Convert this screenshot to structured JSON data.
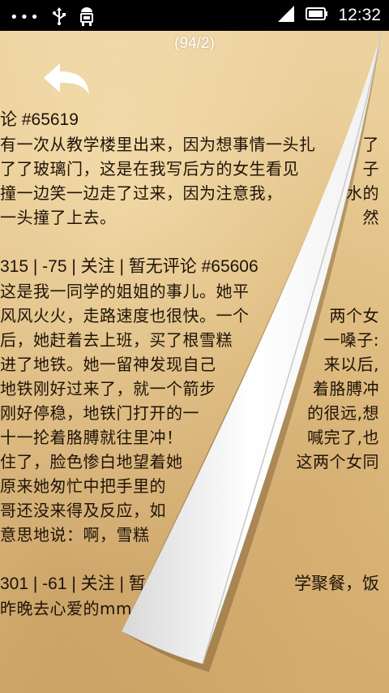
{
  "status_bar": {
    "overflow": "•••",
    "usb_icon": "usb-icon",
    "android_icon": "android-debug-icon",
    "signal_icon": "signal-icon",
    "battery_icon": "battery-icon",
    "time": "12:32"
  },
  "reader": {
    "page_indicator": "(94/2)",
    "back_icon": "back-arrow-icon",
    "page_curl_color": "#ffffff",
    "lines": [
      {
        "text": "论 #65619",
        "type": "meta"
      },
      {
        "text": "有一次从教学楼里出来，因为想事情一头扎",
        "tail": "了"
      },
      {
        "text": "了了玻璃门，这是在我写后方的女生看见",
        "tail": "子"
      },
      {
        "text": "撞一边笑一边走了过来，因为注意我，",
        "tail": "水的"
      },
      {
        "text": "一头撞了上去。",
        "tail": "然"
      },
      {
        "text": "",
        "type": "gap"
      },
      {
        "text": "315 | -75 | 关注 | 暂无评论 #65606",
        "type": "meta"
      },
      {
        "text": "这是我一同学的姐姐的事儿。她平"
      },
      {
        "text": "风风火火，走路速度也很快。一个",
        "tail": "两个女"
      },
      {
        "text": "后，她赶着去上班，买了根雪糕",
        "tail": "一嗓子:"
      },
      {
        "text": "进了地铁。她一留神发现自己",
        "tail": "来以后,"
      },
      {
        "text": "地铁刚好过来了，就一个箭步",
        "tail": "着胳膊冲"
      },
      {
        "text": "刚好停稳，地铁门打开的一",
        "tail": "的很远,想"
      },
      {
        "text": "十一抡着胳膊就往里冲！",
        "tail": "喊完了,也"
      },
      {
        "text": "住了，脸色惨白地望着她",
        "tail": "这两个女同"
      },
      {
        "text": "原来她匆忙中把手里的"
      },
      {
        "text": "哥还没来得及反应，如"
      },
      {
        "text": "意思地说：啊，雪糕"
      },
      {
        "text": "",
        "type": "gap"
      },
      {
        "text": "301 | -61 | 关注 | 暂",
        "type": "meta",
        "tail": "学聚餐，饭"
      },
      {
        "text": "昨晚去心爱的mm"
      }
    ]
  }
}
